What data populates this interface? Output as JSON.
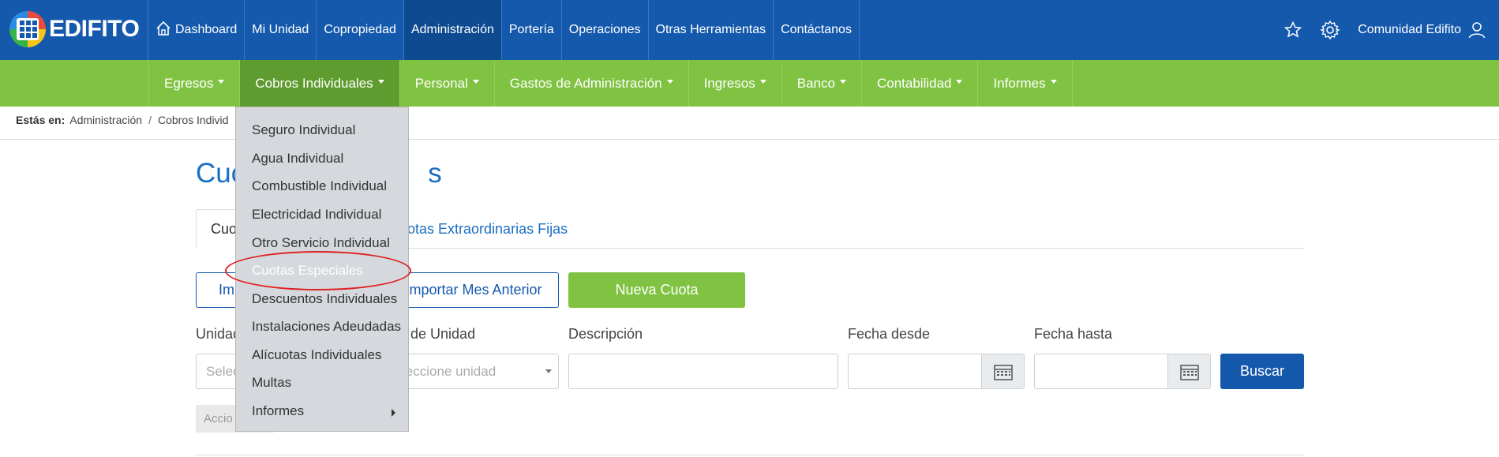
{
  "app": {
    "logo_text": "EDIFITO"
  },
  "topnav": {
    "items": [
      {
        "label": "Dashboard",
        "icon": "home-icon"
      },
      {
        "label": "Mi Unidad"
      },
      {
        "label": "Copropiedad"
      },
      {
        "label": "Administración",
        "active": true
      },
      {
        "label": "Portería"
      },
      {
        "label": "Operaciones"
      },
      {
        "label": "Otras Herramientas"
      },
      {
        "label": "Contáctanos"
      }
    ],
    "user_label": "Comunidad Edifito",
    "icons": [
      "star-icon",
      "gear-icon",
      "user-icon"
    ]
  },
  "subnav": {
    "items": [
      {
        "label": "Egresos"
      },
      {
        "label": "Cobros Individuales",
        "active": true
      },
      {
        "label": "Personal"
      },
      {
        "label": "Gastos de Administración"
      },
      {
        "label": "Ingresos"
      },
      {
        "label": "Banco"
      },
      {
        "label": "Contabilidad"
      },
      {
        "label": "Informes"
      }
    ]
  },
  "breadcrumb": {
    "label": "Estás en:",
    "items": [
      "Administración",
      "Cobros Individ"
    ]
  },
  "page": {
    "title": "Cuo",
    "title_tail": "s",
    "tabs": [
      {
        "label": "Cuo"
      },
      {
        "label": "otas Extraordinarias Fijas"
      }
    ],
    "buttons": {
      "import_left": "Im",
      "import_prev": "mportar Mes Anterior",
      "new": "Nueva Cuota",
      "search": "Buscar"
    },
    "filters": {
      "unidad_label": "Unidad",
      "unidad_placeholder": "Selec",
      "tipo_label": "o de Unidad",
      "tipo_placeholder": "leccione unidad",
      "descripcion_label": "Descripción",
      "desde_label": "Fecha desde",
      "hasta_label": "Fecha hasta"
    },
    "accion_label": "Accio"
  },
  "dropdown": {
    "items": [
      "Seguro Individual",
      "Agua Individual",
      "Combustible Individual",
      "Electricidad Individual",
      "Otro Servicio Individual",
      "Cuotas Especiales",
      "Descuentos Individuales",
      "Instalaciones Adeudadas",
      "Alícuotas Individuales",
      "Multas",
      "Informes"
    ],
    "highlighted": "Cuotas Especiales"
  },
  "colors": {
    "top": "#1559ad",
    "sub": "#80c342",
    "accent": "#1b6fc2",
    "annotation": "#e02020"
  }
}
